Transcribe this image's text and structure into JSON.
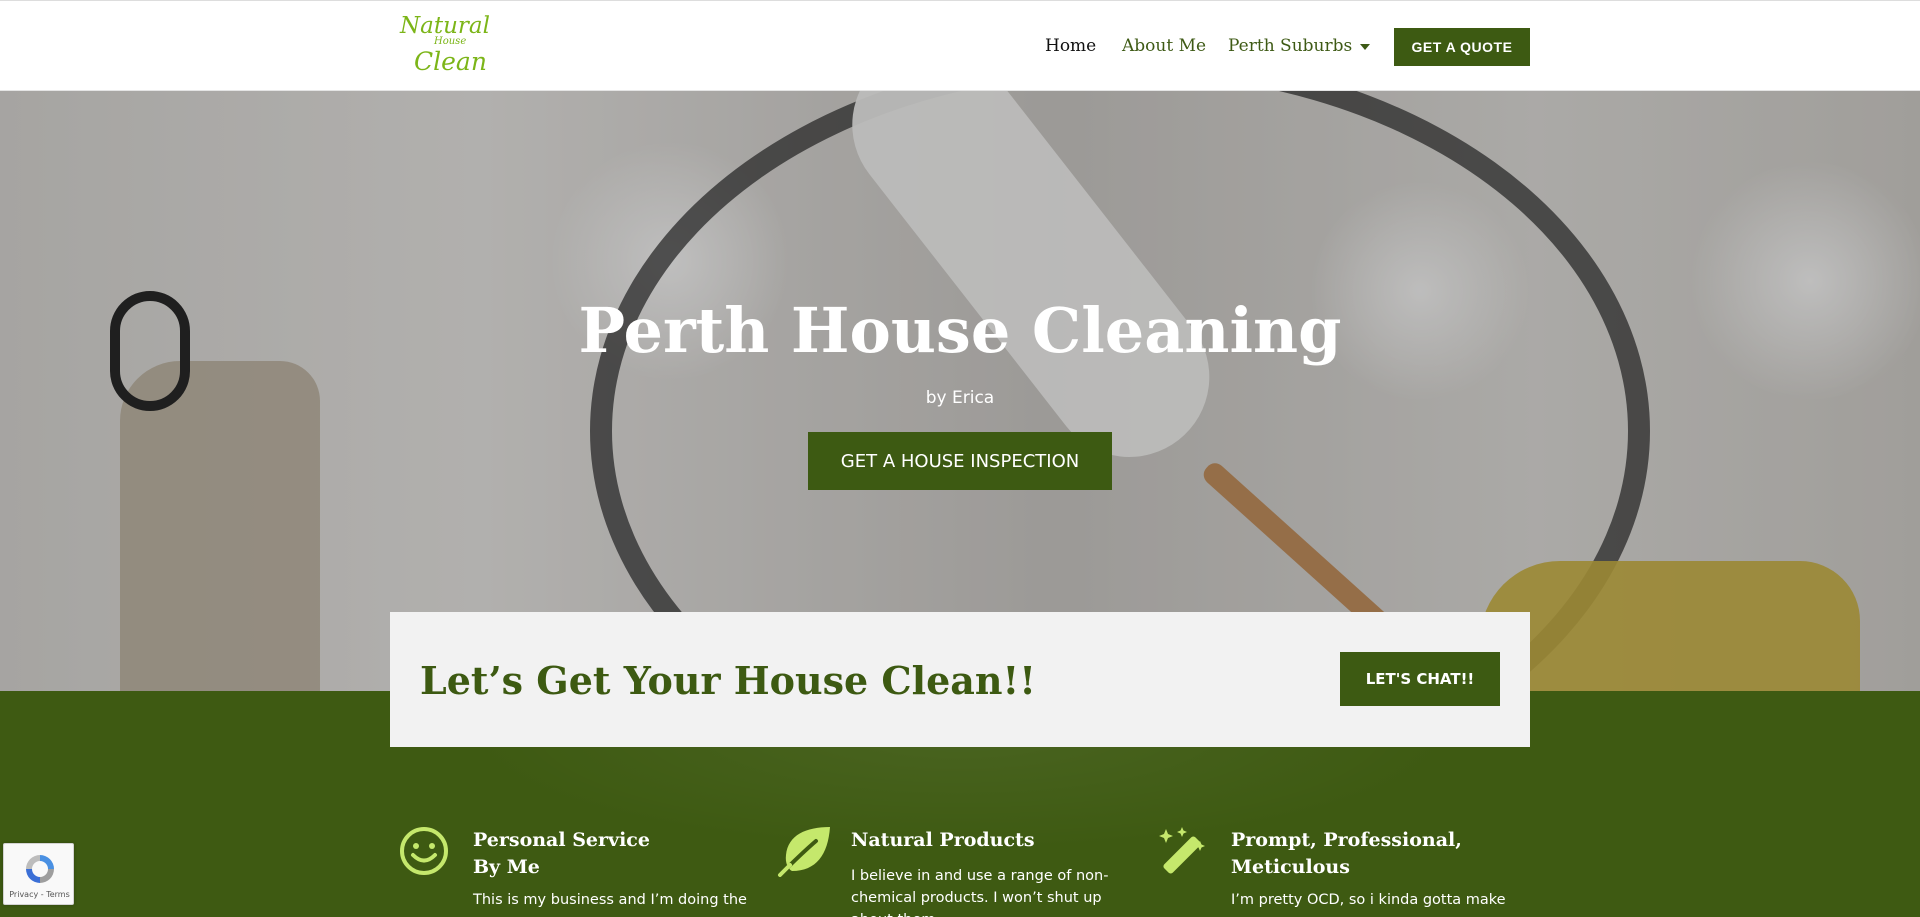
{
  "header": {
    "logo_text": [
      "Natural",
      "House",
      "Clean"
    ],
    "nav": [
      {
        "label": "Home",
        "active": true
      },
      {
        "label": "About Me",
        "active": false
      },
      {
        "label": "Perth Suburbs",
        "active": false,
        "has_dropdown": true
      }
    ],
    "cta_label": "GET A QUOTE"
  },
  "hero": {
    "title": "Perth House Cleaning",
    "subtitle": "by Erica",
    "button_label": "GET A HOUSE INSPECTION"
  },
  "cta_box": {
    "text": "Let’s Get Your House Clean!!",
    "button_label": "LET'S CHAT!!"
  },
  "features": [
    {
      "icon": "smiley-icon",
      "title_line1": "Personal Service",
      "title_line2": "By Me",
      "body": "This is my business and I’m doing the"
    },
    {
      "icon": "leaf-icon",
      "title_line1": "Natural Products",
      "title_line2": "",
      "body": "I believe in and use a range of non-chemical products. I won’t shut up about them."
    },
    {
      "icon": "magic-wand-icon",
      "title_line1": "Prompt, Professional,",
      "title_line2": "Meticulous",
      "body": "I’m pretty OCD, so i kinda gotta make"
    }
  ],
  "recaptcha": {
    "text": "Privacy - Terms"
  },
  "colors": {
    "brand_green": "#3d5a12",
    "accent_lime": "#c5e86c",
    "logo_green": "#7cb518"
  }
}
